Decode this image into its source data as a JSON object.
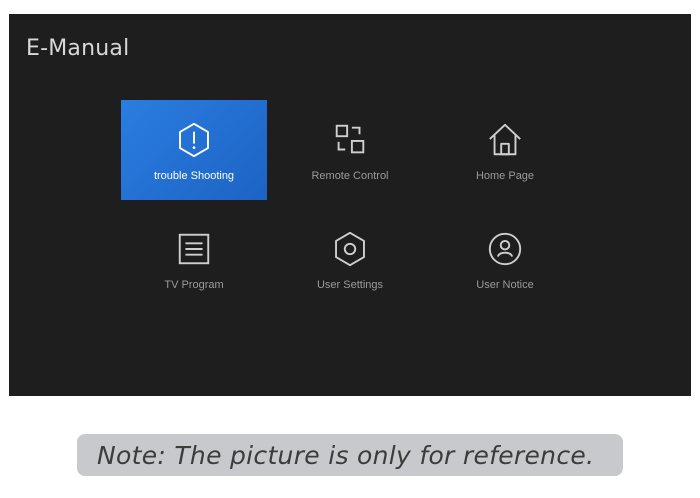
{
  "app": {
    "title": "E-Manual"
  },
  "menu": {
    "items": [
      {
        "label": "trouble Shooting",
        "icon": "alert-hexagon-icon",
        "selected": true
      },
      {
        "label": "Remote Control",
        "icon": "remote-control-icon",
        "selected": false
      },
      {
        "label": "Home Page",
        "icon": "home-icon",
        "selected": false
      },
      {
        "label": "TV Program",
        "icon": "list-icon",
        "selected": false
      },
      {
        "label": "User Settings",
        "icon": "settings-hexagon-icon",
        "selected": false
      },
      {
        "label": "User Notice",
        "icon": "user-icon",
        "selected": false
      }
    ]
  },
  "footer": {
    "note": "Note: The picture is only for reference."
  },
  "colors": {
    "screen_background": "#1e1e1e",
    "selected_tile": "#2a7de0",
    "label_text": "#9a9a9a",
    "note_background": "#c8c9cc"
  }
}
